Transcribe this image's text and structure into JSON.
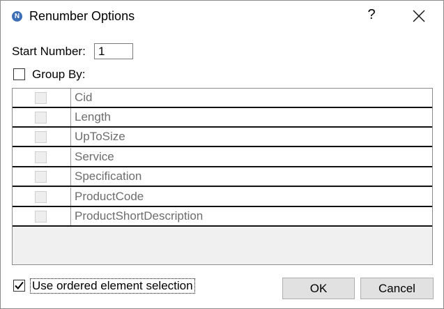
{
  "dialog": {
    "title": "Renumber Options",
    "help_label": "?"
  },
  "form": {
    "start_number_label": "Start Number:",
    "start_number_value": "1",
    "group_by_label": "Group By:",
    "group_by_checked": false
  },
  "group_by_fields": [
    {
      "label": "Cid",
      "checked": false
    },
    {
      "label": "Length",
      "checked": false
    },
    {
      "label": "UpToSize",
      "checked": false
    },
    {
      "label": "Service",
      "checked": false
    },
    {
      "label": "Specification",
      "checked": false
    },
    {
      "label": "ProductCode",
      "checked": false
    },
    {
      "label": "ProductShortDescription",
      "checked": false
    }
  ],
  "footer": {
    "ordered_selection_label": "Use ordered element selection",
    "ordered_selection_checked": true,
    "ok_label": "OK",
    "cancel_label": "Cancel"
  },
  "icons": {
    "app": "app-logo-icon",
    "close": "close-icon",
    "check": "checkmark-icon"
  }
}
